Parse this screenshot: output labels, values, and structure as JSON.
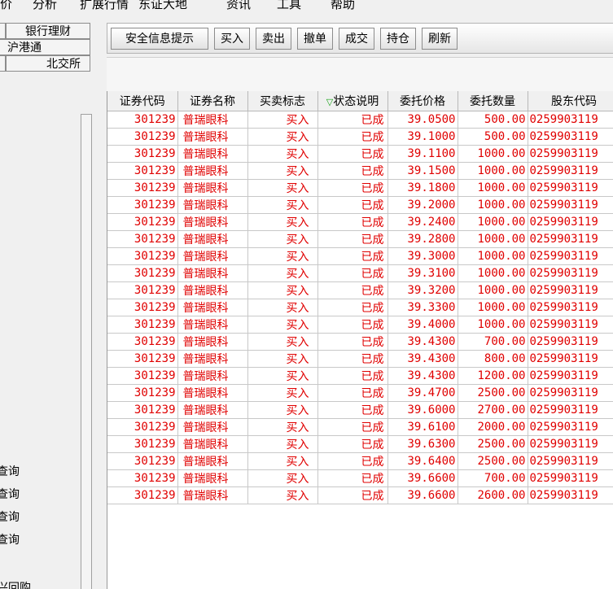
{
  "menu": [
    "价",
    "分析",
    "扩展行情",
    "东证大地",
    "资讯",
    "工具",
    "帮助"
  ],
  "left_panel": {
    "tab_bank": "银行理财",
    "tab_hk": "沪港通",
    "tab_bse": "北交所",
    "links": [
      "查询",
      "查询",
      "查询",
      "查询",
      "兴回购"
    ]
  },
  "toolbar": {
    "security_tip": "安全信息提示",
    "buy": "买入",
    "sell": "卖出",
    "cancel": "撤单",
    "deal": "成交",
    "position": "持仓",
    "refresh": "刷新"
  },
  "table": {
    "headers": [
      "证券代码",
      "证券名称",
      "买卖标志",
      "状态说明",
      "委托价格",
      "委托数量",
      "股东代码"
    ],
    "sort_icon": "▽",
    "rows": [
      [
        "301239",
        "普瑞眼科",
        "买入",
        "已成",
        "39.0500",
        "500.00",
        "0259903119"
      ],
      [
        "301239",
        "普瑞眼科",
        "买入",
        "已成",
        "39.1000",
        "500.00",
        "0259903119"
      ],
      [
        "301239",
        "普瑞眼科",
        "买入",
        "已成",
        "39.1100",
        "1000.00",
        "0259903119"
      ],
      [
        "301239",
        "普瑞眼科",
        "买入",
        "已成",
        "39.1500",
        "1000.00",
        "0259903119"
      ],
      [
        "301239",
        "普瑞眼科",
        "买入",
        "已成",
        "39.1800",
        "1000.00",
        "0259903119"
      ],
      [
        "301239",
        "普瑞眼科",
        "买入",
        "已成",
        "39.2000",
        "1000.00",
        "0259903119"
      ],
      [
        "301239",
        "普瑞眼科",
        "买入",
        "已成",
        "39.2400",
        "1000.00",
        "0259903119"
      ],
      [
        "301239",
        "普瑞眼科",
        "买入",
        "已成",
        "39.2800",
        "1000.00",
        "0259903119"
      ],
      [
        "301239",
        "普瑞眼科",
        "买入",
        "已成",
        "39.3000",
        "1000.00",
        "0259903119"
      ],
      [
        "301239",
        "普瑞眼科",
        "买入",
        "已成",
        "39.3100",
        "1000.00",
        "0259903119"
      ],
      [
        "301239",
        "普瑞眼科",
        "买入",
        "已成",
        "39.3200",
        "1000.00",
        "0259903119"
      ],
      [
        "301239",
        "普瑞眼科",
        "买入",
        "已成",
        "39.3300",
        "1000.00",
        "0259903119"
      ],
      [
        "301239",
        "普瑞眼科",
        "买入",
        "已成",
        "39.4000",
        "1000.00",
        "0259903119"
      ],
      [
        "301239",
        "普瑞眼科",
        "买入",
        "已成",
        "39.4300",
        "700.00",
        "0259903119"
      ],
      [
        "301239",
        "普瑞眼科",
        "买入",
        "已成",
        "39.4300",
        "800.00",
        "0259903119"
      ],
      [
        "301239",
        "普瑞眼科",
        "买入",
        "已成",
        "39.4300",
        "1200.00",
        "0259903119"
      ],
      [
        "301239",
        "普瑞眼科",
        "买入",
        "已成",
        "39.4700",
        "2500.00",
        "0259903119"
      ],
      [
        "301239",
        "普瑞眼科",
        "买入",
        "已成",
        "39.6000",
        "2700.00",
        "0259903119"
      ],
      [
        "301239",
        "普瑞眼科",
        "买入",
        "已成",
        "39.6100",
        "2000.00",
        "0259903119"
      ],
      [
        "301239",
        "普瑞眼科",
        "买入",
        "已成",
        "39.6300",
        "2500.00",
        "0259903119"
      ],
      [
        "301239",
        "普瑞眼科",
        "买入",
        "已成",
        "39.6400",
        "2500.00",
        "0259903119"
      ],
      [
        "301239",
        "普瑞眼科",
        "买入",
        "已成",
        "39.6600",
        "700.00",
        "0259903119"
      ],
      [
        "301239",
        "普瑞眼科",
        "买入",
        "已成",
        "39.6600",
        "2600.00",
        "0259903119"
      ]
    ]
  },
  "colors": {
    "row_text": "#e00000",
    "sort_icon": "#17a317"
  }
}
